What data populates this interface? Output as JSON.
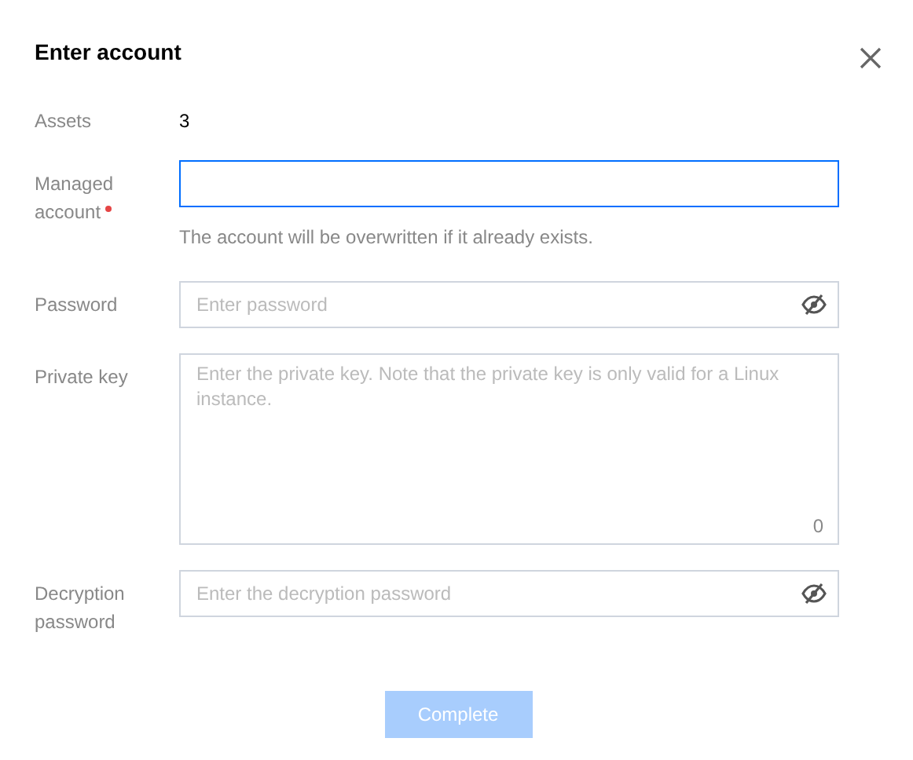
{
  "dialog": {
    "title": "Enter account"
  },
  "rows": [
    {
      "kind": "static",
      "label": "Assets",
      "value": "3"
    },
    {
      "kind": "text",
      "label": "Managed account",
      "required": true,
      "focused": true,
      "hint": "The account will be overwritten if it already exists."
    },
    {
      "kind": "password",
      "label": "Password",
      "required": false,
      "focused": false,
      "placeholder": "Enter password"
    },
    {
      "kind": "textarea",
      "label": "Private key",
      "required": false,
      "focused": false,
      "placeholder": "Enter the private key. Note that the private key is only valid for a Linux instance.",
      "counter": "0"
    },
    {
      "kind": "password",
      "label": "Decryption password",
      "required": false,
      "focused": false,
      "placeholder": "Enter the decryption password"
    }
  ],
  "submit": {
    "label": "Complete",
    "disabled": true
  }
}
